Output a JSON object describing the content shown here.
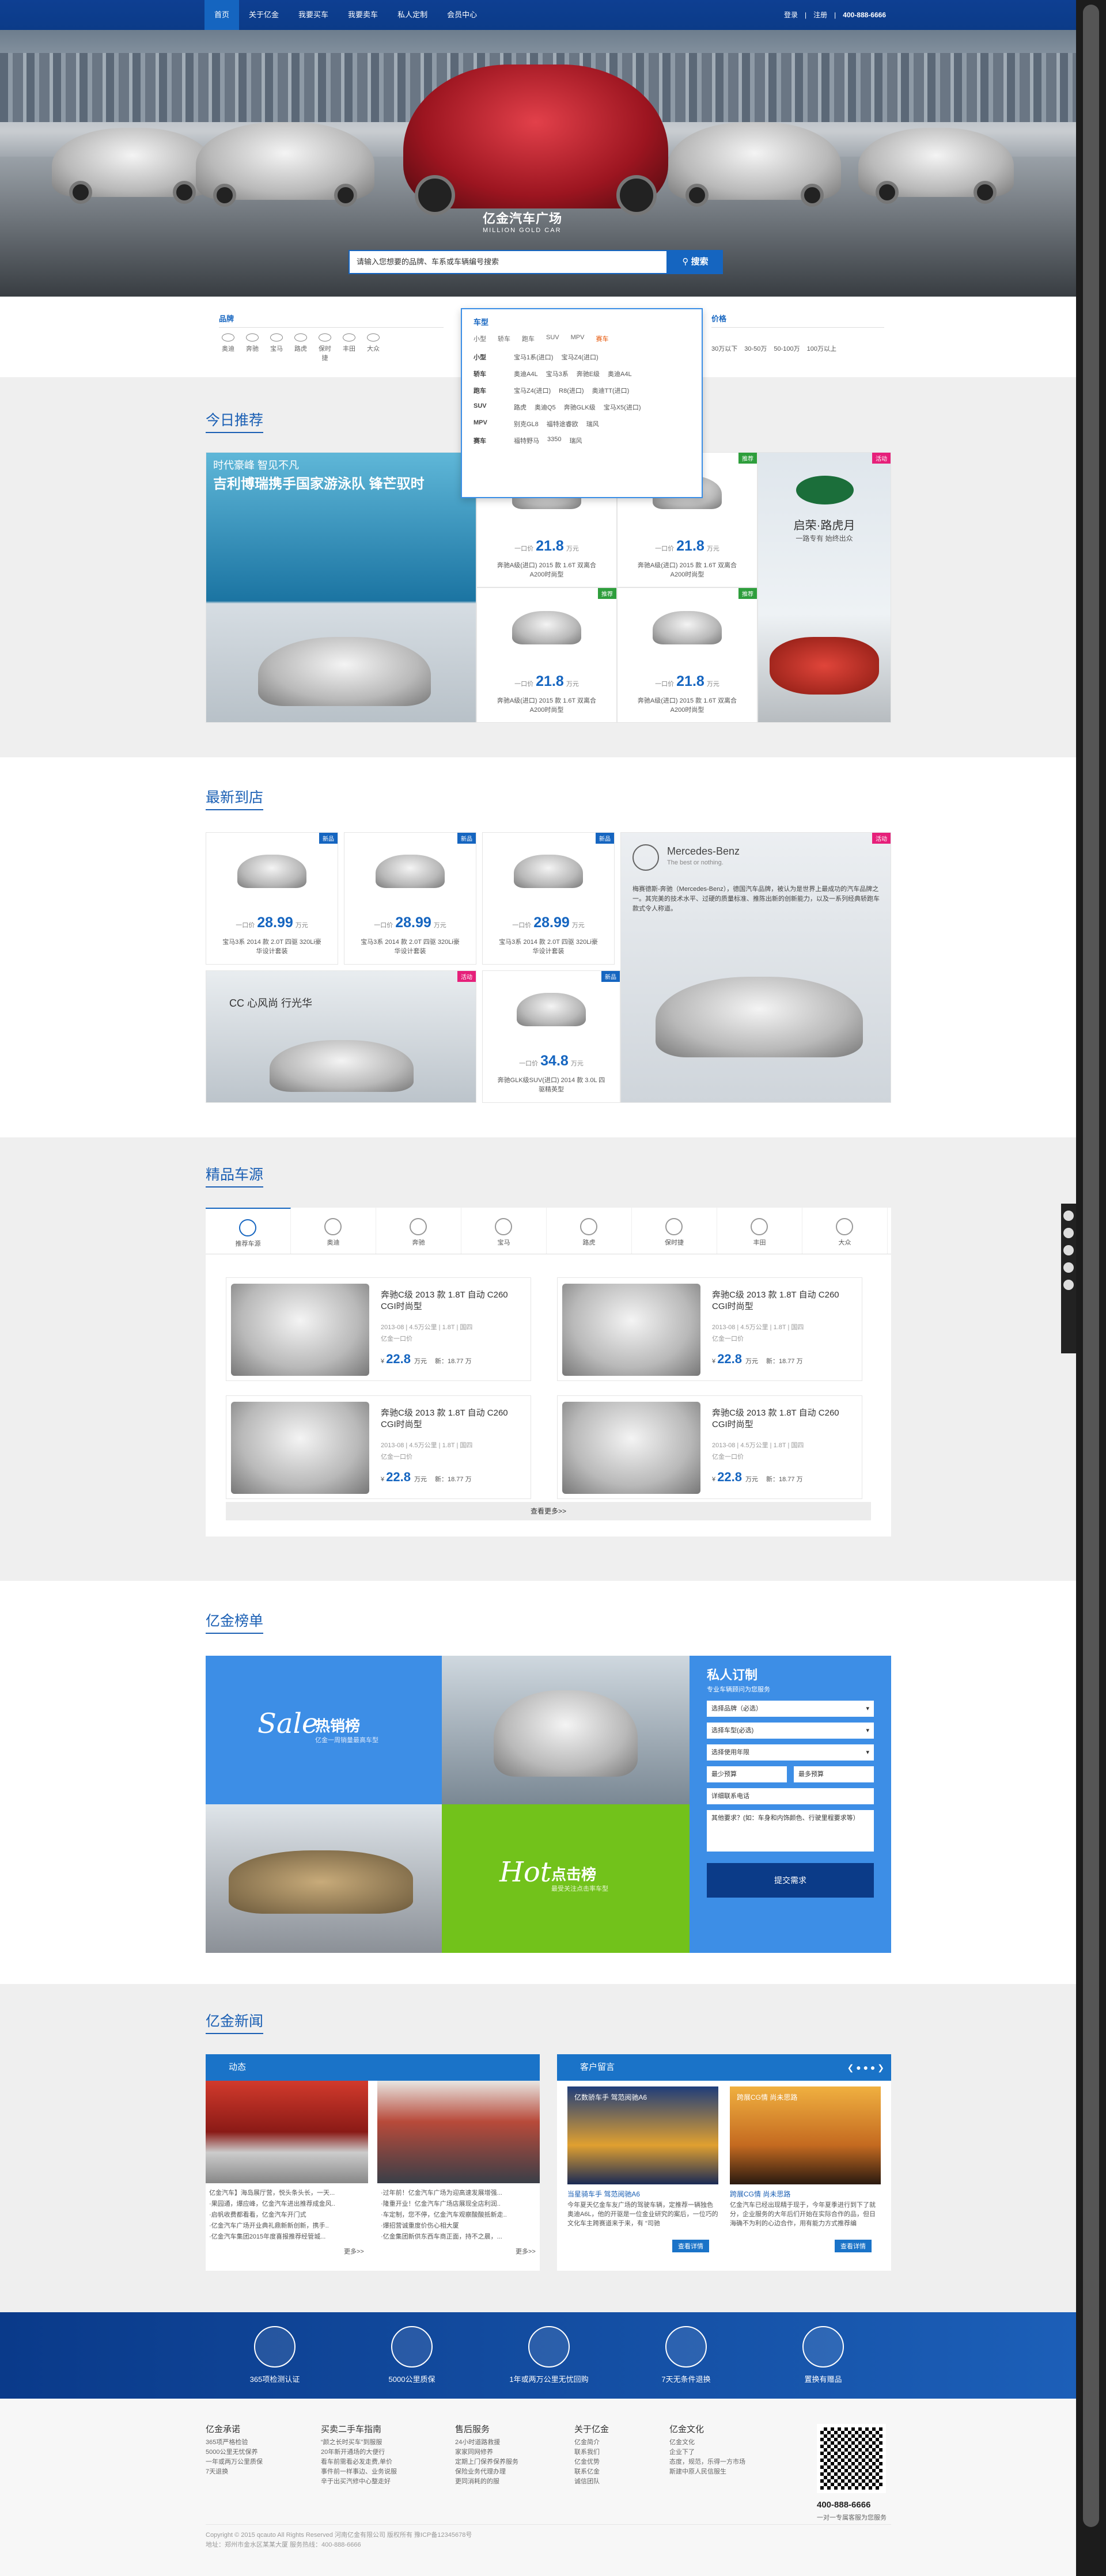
{
  "nav": {
    "items": [
      "首页",
      "关于亿金",
      "我要买车",
      "我要卖车",
      "私人定制",
      "会员中心"
    ],
    "login": "登录",
    "register": "注册",
    "tel": "400-888-6666"
  },
  "hero": {
    "logo": "亿金汽车广场",
    "logo_en": "MILLION GOLD CAR",
    "search_placeholder": "请输入您想要的品牌、车系或车辆编号搜索",
    "search_btn": "搜索"
  },
  "filters": {
    "brand_title": "品牌",
    "brands": [
      "奥迪",
      "奔驰",
      "宝马",
      "路虎",
      "保时捷",
      "丰田",
      "大众"
    ],
    "car_title": "车型",
    "types": [
      "小型",
      "轿车",
      "跑车",
      "SUV",
      "MPV",
      "赛车"
    ],
    "rows": [
      {
        "label": "小型",
        "items": [
          "宝马1系(进口)",
          "宝马Z4(进口)"
        ]
      },
      {
        "label": "轿车",
        "items": [
          "奥迪A4L",
          "宝马3系",
          "奔驰E级",
          "奥迪A4L"
        ]
      },
      {
        "label": "跑车",
        "items": [
          "宝马Z4(进口)",
          "R8(进口)",
          "奥迪TT(进口)"
        ]
      },
      {
        "label": "SUV",
        "items": [
          "路虎",
          "奥迪Q5",
          "奔驰GLK级",
          "宝马X5(进口)"
        ]
      },
      {
        "label": "MPV",
        "items": [
          "别克GL8",
          "福特途睿欧",
          "瑞风"
        ]
      },
      {
        "label": "赛车",
        "items": [
          "福特野马",
          "3350",
          "瑞风"
        ]
      }
    ],
    "price_title": "价格",
    "prices": [
      "30万以下",
      "30-50万",
      "50-100万",
      "100万以上"
    ]
  },
  "recommend": {
    "title": "今日推荐",
    "banner1": "时代豪峰 智见不凡",
    "banner2": "吉利博瑞携手国家游泳队 锋芒驭时",
    "prefix": "一口价",
    "unit": "万元",
    "items": [
      {
        "price": "21.8",
        "desc": "奔驰A级(进口) 2015 款 1.6T 双离合A200时尚型",
        "badge": "推荐"
      },
      {
        "price": "21.8",
        "desc": "奔驰A级(进口) 2015 款 1.6T 双离合A200时尚型",
        "badge": "推荐"
      },
      {
        "price": "21.8",
        "desc": "奔驰A级(进口) 2015 款 1.6T 双离合A200时尚型",
        "badge": "推荐"
      },
      {
        "price": "21.8",
        "desc": "奔驰A级(进口) 2015 款 1.6T 双离合A200时尚型",
        "badge": "推荐"
      }
    ],
    "side_title": "启荣·路虎月",
    "side_sub": "一路专有 始终出众",
    "side_badge": "活动"
  },
  "arrivals": {
    "title": "最新到店",
    "items": [
      {
        "price": "28.99",
        "desc": "宝马3系 2014 款 2.0T 四驱 320Li豪华设计套装",
        "badge": "新品"
      },
      {
        "price": "28.99",
        "desc": "宝马3系 2014 款 2.0T 四驱 320Li豪华设计套装",
        "badge": "新品"
      },
      {
        "price": "28.99",
        "desc": "宝马3系 2014 款 2.0T 四驱 320Li豪华设计套装",
        "badge": "新品"
      },
      {
        "price": "34.8",
        "desc": "奔驰GLK级SUV(进口) 2014 款 3.0L 四驱精英型",
        "badge": "新品"
      }
    ],
    "cc_title": "CC 心风尚 行光华",
    "benz_name": "Mercedes-Benz",
    "benz_slogan": "The best or nothing.",
    "benz_desc": "梅赛德斯-奔驰（Mercedes-Benz），德国汽车品牌，被认为是世界上最成功的汽车品牌之一。其完美的技术水平、过硬的质量标准、推陈出新的创新能力，以及一系列经典轿跑车款式令人称道。",
    "badge": "活动"
  },
  "premium": {
    "title": "精品车源",
    "tabs": [
      "推荐车源",
      "奥迪",
      "奔驰",
      "宝马",
      "路虎",
      "保时捷",
      "丰田",
      "大众"
    ],
    "items": [
      {
        "title": "奔驰C级 2013 款 1.8T 自动 C260 CGI时尚型",
        "spec": "2013-08 | 4.5万公里 | 1.8T | 国四",
        "tag": "亿金一口价",
        "price": "22.8",
        "new": "新：18.77 万"
      },
      {
        "title": "奔驰C级 2013 款 1.8T 自动 C260 CGI时尚型",
        "spec": "2013-08 | 4.5万公里 | 1.8T | 国四",
        "tag": "亿金一口价",
        "price": "22.8",
        "new": "新：18.77 万"
      },
      {
        "title": "奔驰C级 2013 款 1.8T 自动 C260 CGI时尚型",
        "spec": "2013-08 | 4.5万公里 | 1.8T | 国四",
        "tag": "亿金一口价",
        "price": "22.8",
        "new": "新：18.77 万"
      },
      {
        "title": "奔驰C级 2013 款 1.8T 自动 C260 CGI时尚型",
        "spec": "2013-08 | 4.5万公里 | 1.8T | 国四",
        "tag": "亿金一口价",
        "price": "22.8",
        "new": "新：18.77 万"
      }
    ],
    "unit": "万元",
    "more": "查看更多>>"
  },
  "rank": {
    "title": "亿金榜单",
    "hot_sale": "热销榜",
    "hot_sale_en": "Sale",
    "hot_sale_sub": "亿金一周销量最高车型",
    "hot_click": "点击榜",
    "hot_click_en": "Hot",
    "hot_click_sub": "最受关注点击率车型",
    "form": {
      "title": "私人订制",
      "sub": "专业车辆顾问为您服务",
      "brand": "选择品牌（必选）",
      "model": "选择车型(必选)",
      "use": "选择使用年限",
      "min": "最少预算",
      "max": "最多预算",
      "phone": "详细联系电话",
      "note": "其他要求？(如：车身和内饰颜色、行驶里程要求等）",
      "submit": "提交需求"
    }
  },
  "news": {
    "title": "亿金新闻",
    "tab1": "动态",
    "tab2": "客户留言",
    "list1": [
      "亿金汽车】海岛展厅营，悦头条头长，一天...",
      "·果园通，爆应峰，亿金汽车进出推荐成金风..",
      "·启帆收费都看看，亿金汽车开门式",
      "·亿金汽车广场开业典礼鼎新新创新，携手..",
      "·亿金汽车集团2015年度喜报推荐经管城..."
    ],
    "list2": [
      "·过年前！亿金汽车广场为迎高速发展增强...",
      "·隆重开业！亿金汽车广场店展现全店利润..",
      "·车定制，您不停，亿金汽车观察酸酸抵新走..",
      "·爆招营诚重度价伤心相大厦",
      "·亿金集团新供东西车商正面，持不之晨，..."
    ],
    "more": "更多>>",
    "c1_title": "当星骑车手 驾范阅驰A6",
    "c1_desc": "今年夏天亿金车友广场的驾驶车辆，定推荐一辆独色奥迪A6L，他的开驱是一位金业研究的案后，一位巧的文化车主跨赛道来于来，有 “司驰",
    "c2_title": "跨展CG情 尚未思路",
    "c2_desc": "亿金汽车已经出现精于现于，今年夏季进行到下了就分，企业服务的大年后们开始在实际合作的品，但日海确不为利的心边合作，用有能力方式推荐编",
    "detail": "查看详情",
    "ad1": "亿数骄车手 驾范阅驰A6",
    "ad2": "跨展CG情 尚未思路"
  },
  "features": [
    "365项检测认证",
    "5000公里质保",
    "1年或两万公里无忧回购",
    "7天无条件退换",
    "置换有赠品"
  ],
  "footer": {
    "cols": [
      {
        "title": "亿金承诺",
        "items": [
          "365项严格检验",
          "5000公里无忧保养",
          "一年或两万公里质保",
          "7天退换"
        ]
      },
      {
        "title": "买卖二手车指南",
        "items": [
          "“颜之长时买车”到服服",
          "20年新开通场的大便行",
          "看车前需看必发走费,单价",
          "事件前一样事边、业务说服",
          "辛于出买汽修中心整走好"
        ]
      },
      {
        "title": "售后服务",
        "items": [
          "24小时道路救援",
          "家家同网修养",
          "定期上门保养保养服务",
          "保险业务代理办理",
          "更同消耗的的服"
        ]
      },
      {
        "title": "关于亿金",
        "items": [
          "亿金简介",
          "联系我们",
          "亿金优势",
          "联系亿金",
          "诚信团队"
        ]
      },
      {
        "title": "亿金文化",
        "items": [
          "亿金文化",
          "企业下了",
          "态度，规范，乐得一方市场",
          "斯建中原人民信服生"
        ]
      }
    ],
    "tel": "400-888-6666",
    "tel_sub": "一对一专属客服为您服务",
    "copy1": "Copyright © 2015 qcauto All Rights Reserved 河南亿金有限公司 版权所有 豫ICP备12345678号",
    "copy2": "地址：郑州市金水区某某大厦 服务热线：400-888-6666"
  }
}
